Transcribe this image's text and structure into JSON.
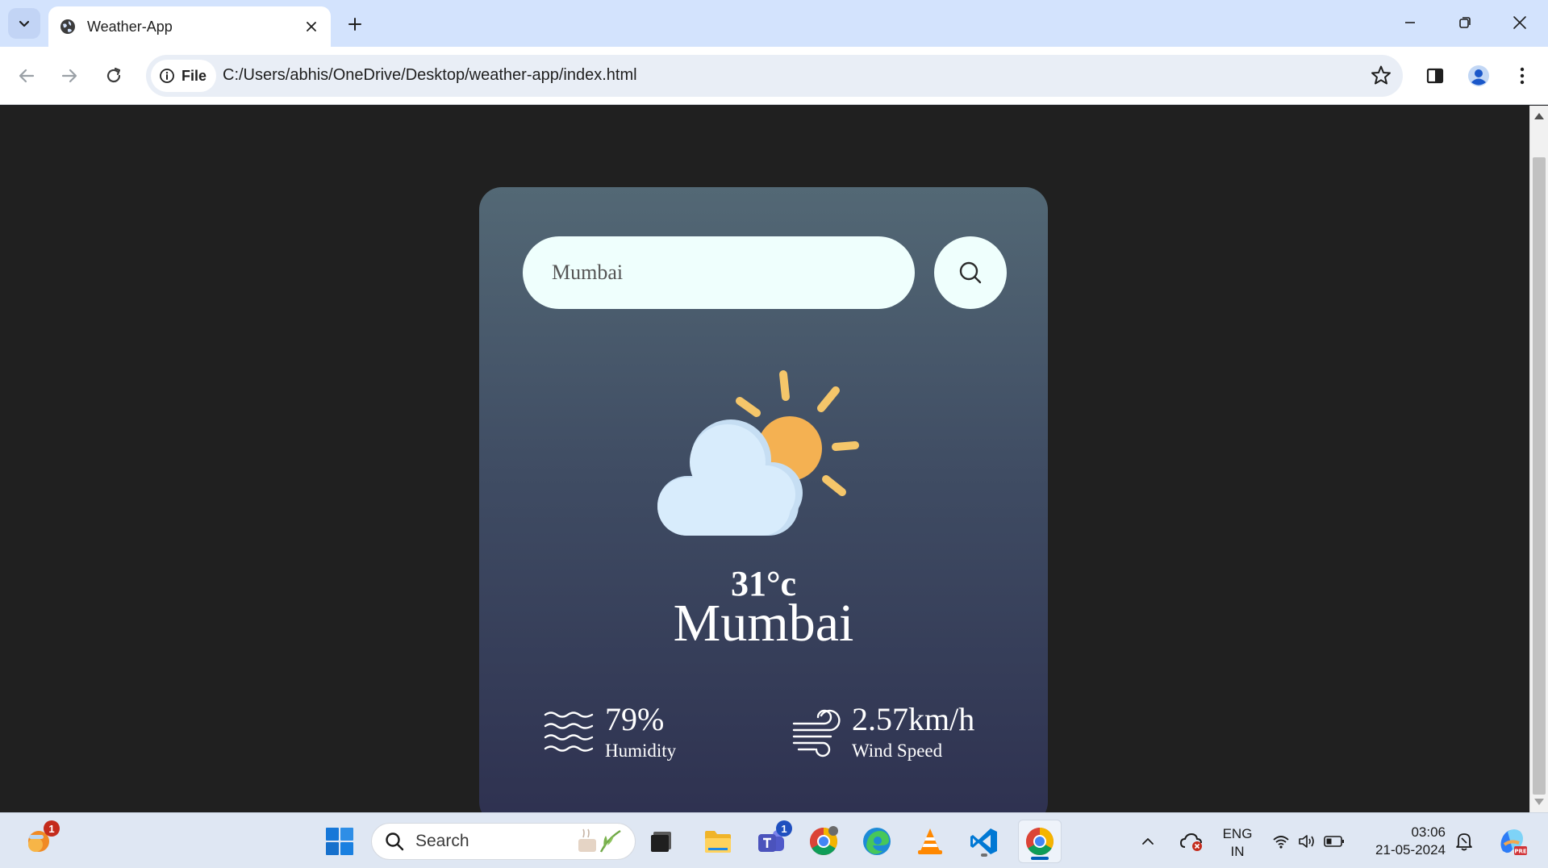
{
  "browser": {
    "tab_title": "Weather-App",
    "file_chip_label": "File",
    "url": "C:/Users/abhis/OneDrive/Desktop/weather-app/index.html"
  },
  "app": {
    "search_value": "Mumbai",
    "temperature": "31°c",
    "city": "Mumbai",
    "humidity_value": "79%",
    "humidity_label": "Humidity",
    "wind_value": "2.57km/h",
    "wind_label": "Wind Speed",
    "weather_icon": "partly-cloudy-icon"
  },
  "taskbar": {
    "search_placeholder": "Search",
    "weather_badge": "1",
    "teams_badge": "1",
    "lang_top": "ENG",
    "lang_bottom": "IN",
    "time": "03:06",
    "date": "21-05-2024"
  },
  "colors": {
    "card_top": "#536875",
    "card_bottom": "#2e3150",
    "input_bg": "#effffd",
    "sun": "#f4b152",
    "cloud": "#d8ecfc"
  }
}
